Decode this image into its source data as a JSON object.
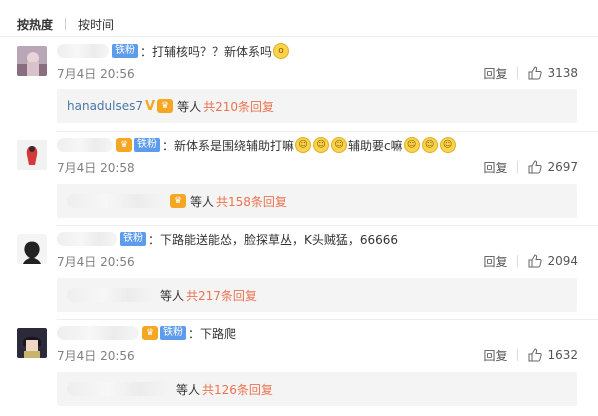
{
  "sort_tabs": {
    "hot": "按热度",
    "time": "按时间"
  },
  "labels": {
    "reply": "回复",
    "fan_badge": "铁粉",
    "vip_badge": "V"
  },
  "comments": [
    {
      "text": "：打辅核吗？？新体系吗",
      "date": "7月4日 20:56",
      "likes": "3138",
      "reply_user": "hanadulses7",
      "reply_etc": "等人",
      "reply_count": "共210条回复"
    },
    {
      "text": "：新体系是围绕辅助打嘛",
      "text2": "辅助要c嘛",
      "date": "7月4日 20:58",
      "likes": "2697",
      "reply_etc": "等人",
      "reply_count": "共158条回复"
    },
    {
      "text": "：下路能送能怂，脸探草丛，K头贼猛，66666",
      "date": "7月4日 20:56",
      "likes": "2094",
      "reply_etc": "等人",
      "reply_count": "共217条回复"
    },
    {
      "text": "：下路爬",
      "date": "7月4日 20:56",
      "likes": "1632",
      "reply_etc": "等人",
      "reply_count": "共126条回复"
    }
  ]
}
